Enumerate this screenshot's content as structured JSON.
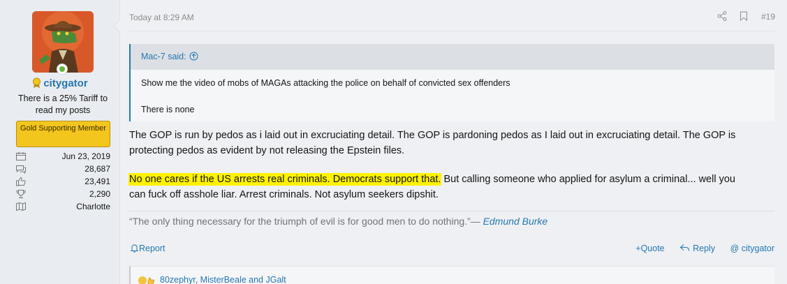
{
  "user": {
    "username": "citygator",
    "title": "There is a 25% Tariff to read my posts",
    "banner": "Gold Supporting Member",
    "stats": [
      {
        "icon": "calendar-icon",
        "value": "Jun 23, 2019"
      },
      {
        "icon": "messages-icon",
        "value": "28,687"
      },
      {
        "icon": "thumbs-up-icon",
        "value": "23,491"
      },
      {
        "icon": "trophy-icon",
        "value": "2,290"
      },
      {
        "icon": "map-icon",
        "value": "Charlotte"
      }
    ]
  },
  "post": {
    "date": "Today at 8:29 AM",
    "number": "#19",
    "quote": {
      "author_line": "Mac-7 said:",
      "line1": "Show me the video of mobs of MAGAs attacking the police on behalf of convicted sex offenders",
      "line2": "There is none"
    },
    "para1_line1": "The GOP is run by pedos as i laid out in excruciating detail. The GOP is pardoning pedos as I laid out in excruciating detail. The GOP is",
    "para1_line2": "protecting pedos as evident by not releasing the Epstein files.",
    "para2_highlight": "No one cares if the US arrests real criminals. Democrats support that.",
    "para2_rest": " But calling someone who applied for asylum a criminal... well you",
    "para2_line2": "can fuck off asshole liar. Arrest criminals. Not asylum seekers dipshit.",
    "signature_quote": "“The only thing necessary for the triumph of evil is for good men to do nothing.”",
    "signature_dash": "— ",
    "signature_author": "Edmund Burke"
  },
  "footer": {
    "report": "Report",
    "quote": "Quote",
    "reply": "Reply",
    "mention": "citygator",
    "reactions": "80zephyr, MisterBeale and JGalt"
  },
  "colors": {
    "link": "#2577b1",
    "highlight": "#fff200",
    "banner": "#f3c61e"
  }
}
